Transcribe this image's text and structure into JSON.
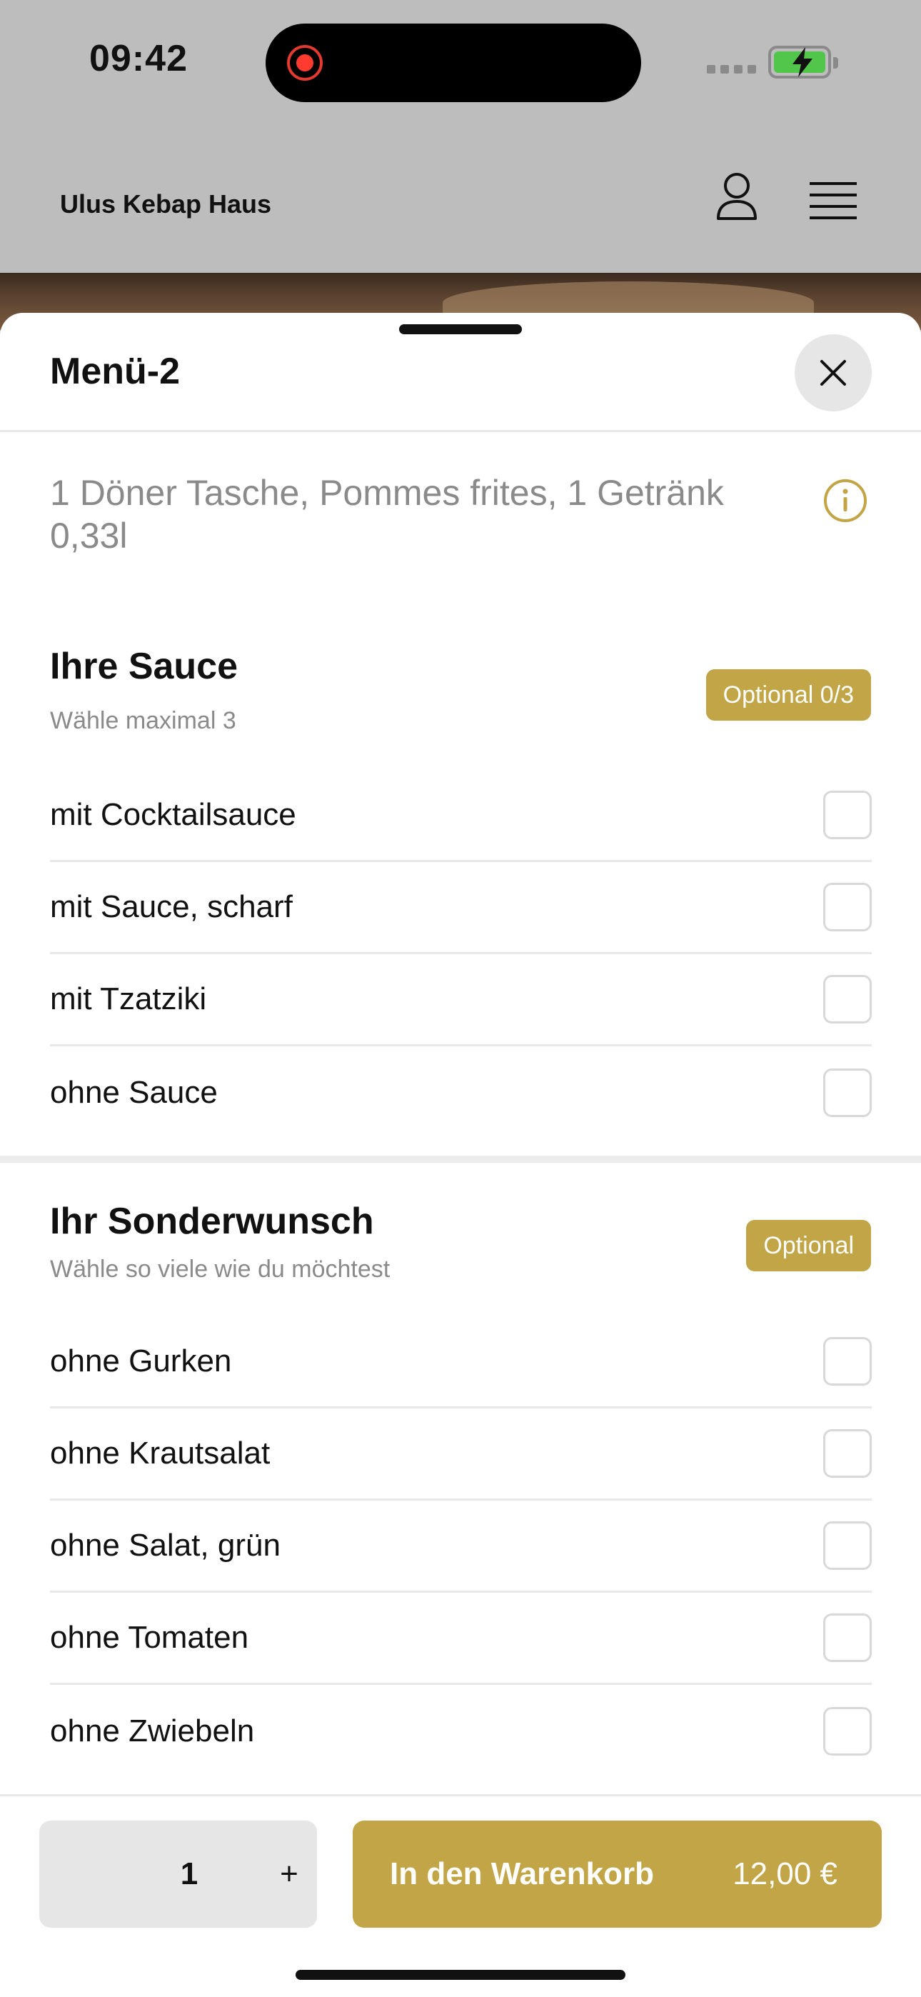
{
  "status_bar": {
    "time": "09:42"
  },
  "app": {
    "brand": "Ulus Kebap Haus"
  },
  "sheet": {
    "title": "Menü-2",
    "description": "1 Döner Tasche, Pommes frites, 1 Getränk 0,33l"
  },
  "groups": [
    {
      "title": "Ihre Sauce",
      "subtitle": "Wähle maximal 3",
      "badge": "Optional 0/3",
      "options": [
        "mit Cocktailsauce",
        "mit Sauce, scharf",
        "mit Tzatziki",
        "ohne Sauce"
      ]
    },
    {
      "title": "Ihr Sonderwunsch",
      "subtitle": "Wähle so viele wie du möchtest",
      "badge": "Optional",
      "options": [
        "ohne Gurken",
        "ohne Krautsalat",
        "ohne Salat, grün",
        "ohne Tomaten",
        "ohne Zwiebeln"
      ]
    }
  ],
  "action_bar": {
    "quantity": "1",
    "plus": "+",
    "add_label": "In den Warenkorb",
    "price": "12,00 €"
  },
  "colors": {
    "accent": "#c1a547",
    "dim_background": "#bdbdbd"
  }
}
